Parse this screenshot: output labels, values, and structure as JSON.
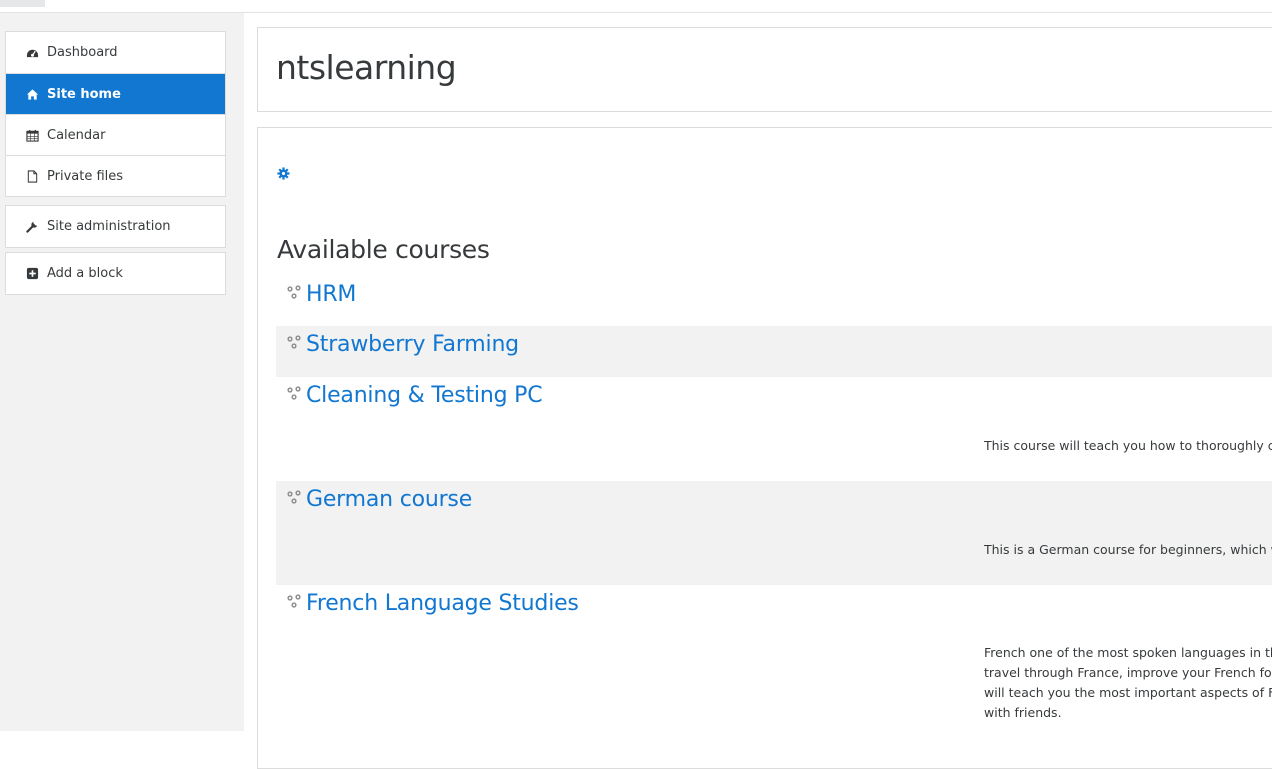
{
  "site": {
    "title": "ntslearning"
  },
  "nav": {
    "primary": [
      {
        "label": "Dashboard",
        "icon": "dashboard-icon"
      },
      {
        "label": "Site home",
        "icon": "home-icon",
        "active": true
      },
      {
        "label": "Calendar",
        "icon": "calendar-icon"
      },
      {
        "label": "Private files",
        "icon": "file-icon"
      }
    ],
    "admin": {
      "label": "Site administration",
      "icon": "wrench-icon"
    },
    "add_block": {
      "label": "Add a block",
      "icon": "plus-square-icon"
    }
  },
  "main": {
    "section_title": "Available courses",
    "courses": [
      {
        "name": "HRM",
        "summary": ""
      },
      {
        "name": "Strawberry Farming",
        "summary": ""
      },
      {
        "name": "Cleaning & Testing PC",
        "summary": "This course will teach you how to thoroughly clea"
      },
      {
        "name": "German course",
        "summary": "This is a German course for beginners, which will"
      },
      {
        "name": "French Language Studies",
        "summary": "French one of the most spoken languages in the\ntravel through France, improve your French for s\nwill teach you the most important aspects of Fren\nwith friends."
      }
    ]
  },
  "colors": {
    "accent": "#1177d1",
    "sidebar_bg": "#f2f2f2",
    "stripe_bg": "#f2f2f2",
    "border": "#dcdcdc"
  }
}
